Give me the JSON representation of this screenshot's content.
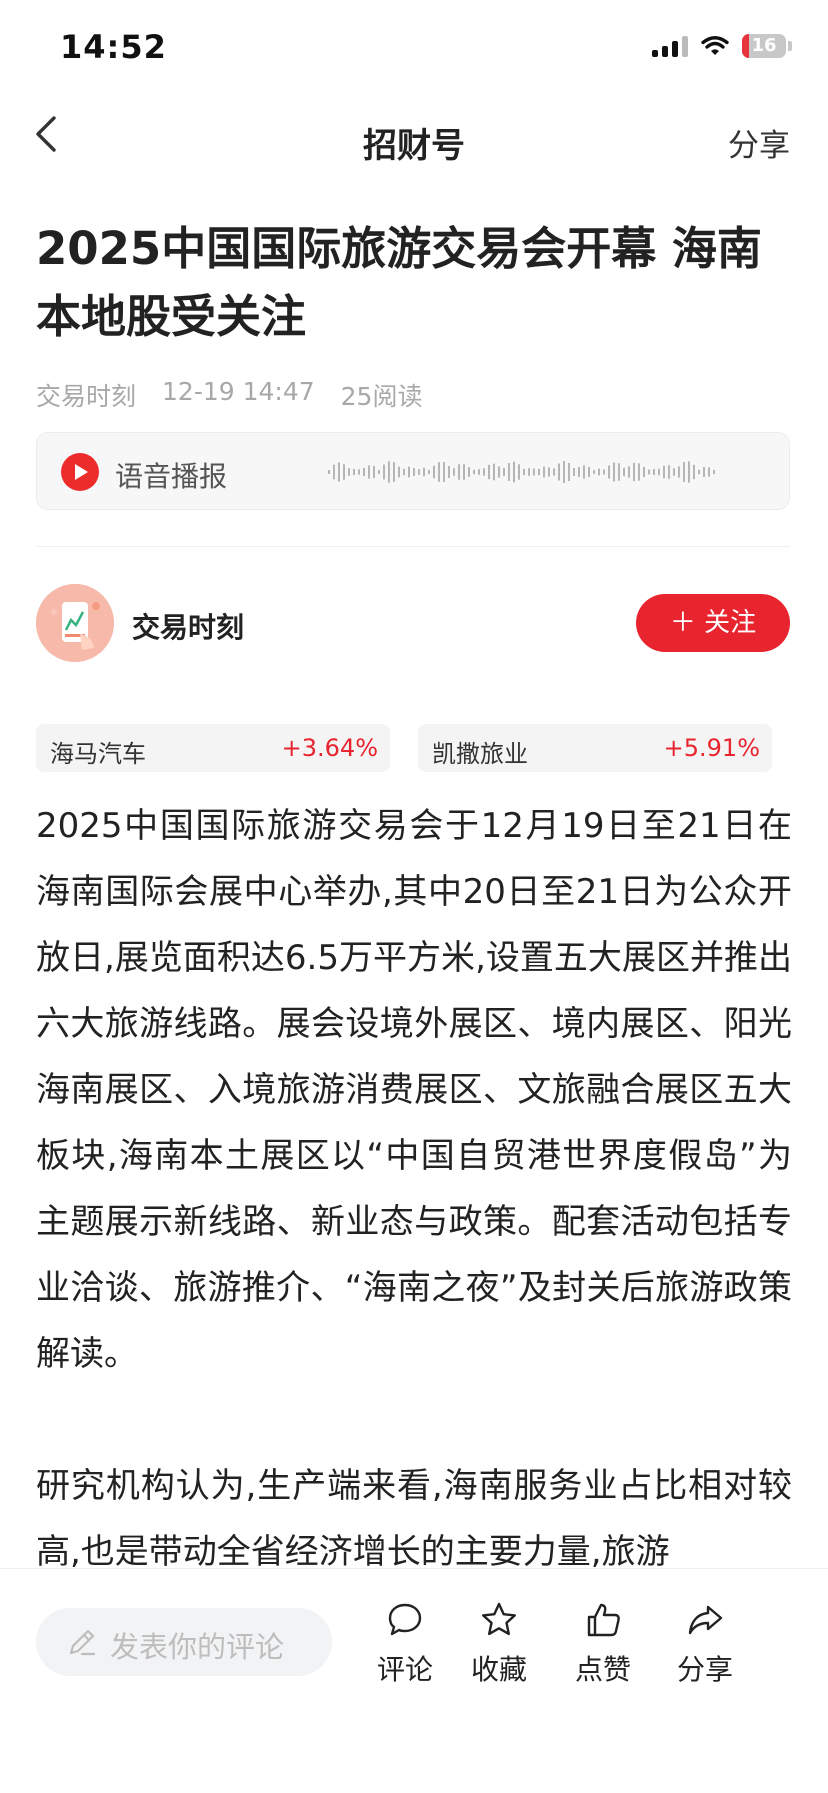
{
  "status": {
    "time": "14:52",
    "battery": "16",
    "battery_level": 0.16
  },
  "nav": {
    "back_icon": "chevron-left-icon",
    "title": "招财号",
    "share": "分享"
  },
  "article": {
    "title": "2025中国国际旅游交易会开幕 海南本地股受关注",
    "meta": {
      "source": "交易时刻",
      "time": "12-19 14:47",
      "reads": "25阅读"
    },
    "audio_label": "语音播报",
    "author": {
      "name": "交易时刻",
      "follow_label": "＋ 关注"
    },
    "stocks": [
      {
        "name": "海马汽车",
        "change": "+3.64%"
      },
      {
        "name": "凯撒旅业",
        "change": "+5.91%"
      }
    ],
    "paragraphs": [
      "2025中国国际旅游交易会于12月19日至21日在海南国际会展中心举办,其中20日至21日为公众开放日,展览面积达6.5万平方米,设置五大展区并推出六大旅游线路。展会设境外展区、境内展区、阳光海南展区、入境旅游消费展区、文旅融合展区五大板块,海南本土展区以“中国自贸港世界度假岛”为主题展示新线路、新业态与政策。配套活动包括专业洽谈、旅游推介、“海南之夜”及封关后旅游政策解读。",
      "研究机构认为,生产端来看,海南服务业占比相对较高,也是带动全省经济增长的主要力量,旅游"
    ]
  },
  "bottom": {
    "comment_placeholder": "发表你的评论",
    "actions": [
      {
        "label": "评论",
        "icon": "comment-icon"
      },
      {
        "label": "收藏",
        "icon": "star-icon"
      },
      {
        "label": "点赞",
        "icon": "thumbs-up-icon"
      },
      {
        "label": "分享",
        "icon": "share-icon"
      }
    ]
  },
  "colors": {
    "accent": "#e8242f",
    "muted": "#a8a8a8"
  }
}
